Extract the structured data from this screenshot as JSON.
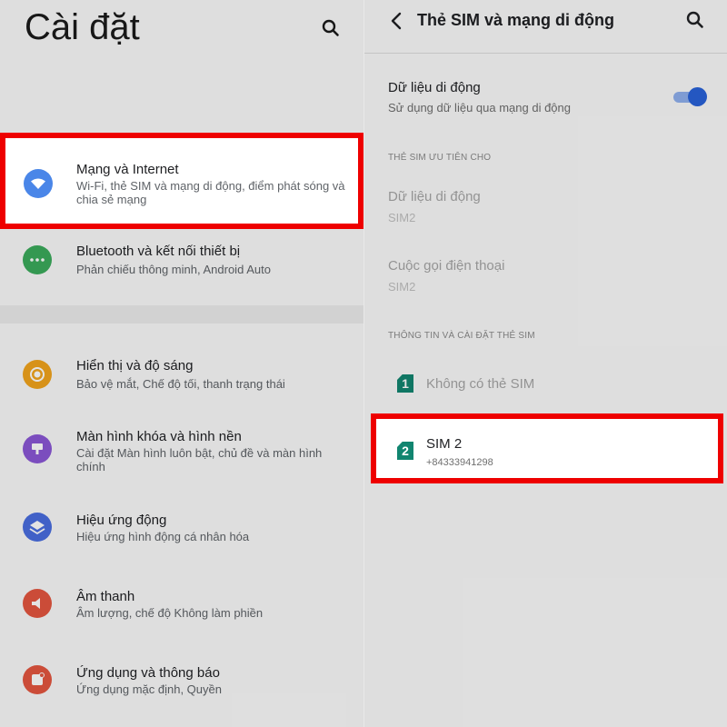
{
  "settings": {
    "title": "Cài đặt",
    "search_icon": "search-icon",
    "items": [
      {
        "title": "Mạng và Internet",
        "subtitle": "Wi-Fi, thẻ SIM và mạng di động, điểm phát sóng và chia sẻ mạng",
        "icon": "wifi-icon",
        "color": "#4a86e8"
      },
      {
        "title": "Bluetooth và kết nối thiết bị",
        "subtitle": "Phản chiếu thông minh, Android Auto",
        "icon": "more-dots-icon",
        "color": "#3bab5c"
      },
      {
        "title": "Hiển thị và độ sáng",
        "subtitle": "Bảo vệ mắt, Chế độ tối, thanh trạng thái",
        "icon": "brightness-icon",
        "color": "#f2a51d"
      },
      {
        "title": "Màn hình khóa và hình nền",
        "subtitle": "Cài đặt Màn hình luôn bật, chủ đề và màn hình chính",
        "icon": "wallpaper-icon",
        "color": "#8b57d6"
      },
      {
        "title": "Hiệu ứng động",
        "subtitle": "Hiệu ứng hình động cá nhân hóa",
        "icon": "layers-icon",
        "color": "#4a6ee0"
      },
      {
        "title": "Âm thanh",
        "subtitle": "Âm lượng, chế độ Không làm phiền",
        "icon": "speaker-icon",
        "color": "#e4563f"
      },
      {
        "title": "Ứng dụng và thông báo",
        "subtitle": "Ứng dụng mặc định, Quyền",
        "icon": "apps-icon",
        "color": "#e4563f"
      }
    ]
  },
  "sim": {
    "title": "Thẻ SIM và mạng di động",
    "back_icon": "back-arrow-icon",
    "search_icon": "search-icon",
    "mobile_data": {
      "title": "Dữ liệu di động",
      "subtitle": "Sử dụng dữ liệu qua mạng di động",
      "enabled": true
    },
    "preferred_section": "THẺ SIM ƯU TIÊN CHO",
    "preferred_data": {
      "title": "Dữ liệu di động",
      "value": "SIM2"
    },
    "preferred_calls": {
      "title": "Cuộc gọi điện thoại",
      "value": "SIM2"
    },
    "info_section": "THÔNG TIN VÀ CÀI ĐẶT THẺ SIM",
    "sim1": {
      "badge": "1",
      "label": "Không có thẻ SIM"
    },
    "sim2": {
      "badge": "2",
      "label": "SIM 2",
      "number": "+84333941298"
    }
  },
  "colors": {
    "highlight_border": "#ee0000",
    "sim_icon": "#118570",
    "toggle_on": "#2962d9"
  }
}
